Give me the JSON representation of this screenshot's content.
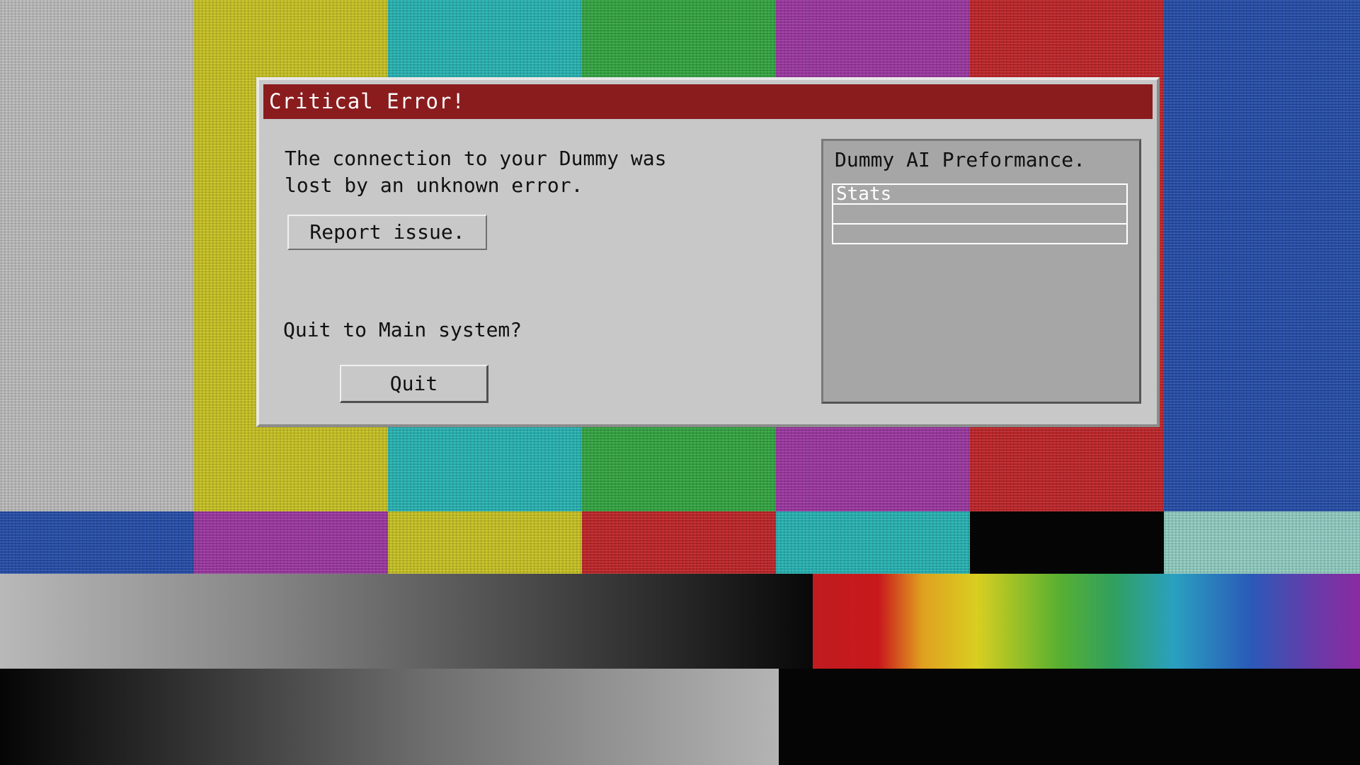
{
  "background": {
    "colors": {
      "white": "#bdbdbd",
      "yellow": "#c9c31a",
      "cyan": "#1fb3b3",
      "green": "#2ba53a",
      "magenta": "#9a2fa0",
      "red": "#c01c20",
      "blue": "#1d47a8",
      "black": "#050505"
    }
  },
  "dialog": {
    "title": "Critical Error!",
    "title_color": "#8b1c1e",
    "message": "The connection to your Dummy was\nlost by an unknown error.",
    "report_button": "Report issue.",
    "quit_question": "Quit to Main system?",
    "quit_button": "Quit"
  },
  "performance_panel": {
    "title": "Dummy AI Preformance.",
    "rows": [
      "Stats",
      "",
      ""
    ]
  }
}
